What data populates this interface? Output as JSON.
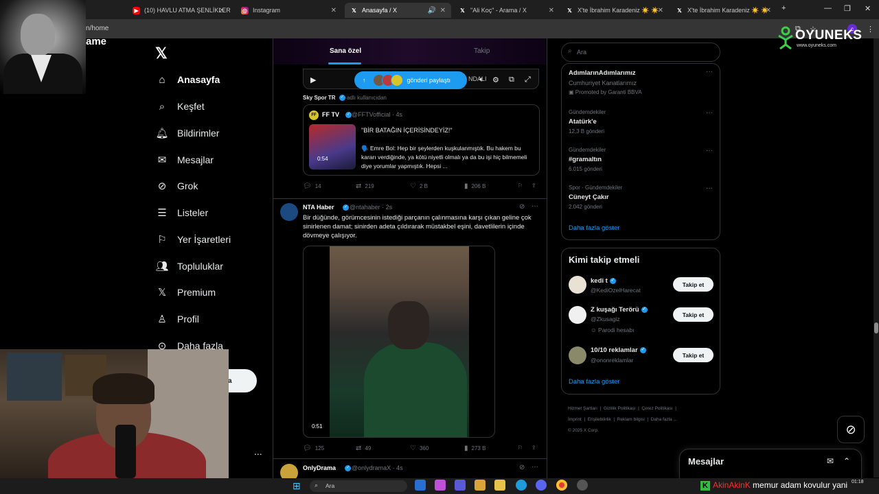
{
  "browser": {
    "tabs": [
      {
        "title": "(10) HAVLU ATMA ŞENLİKLERİ",
        "icon": "youtube-icon"
      },
      {
        "title": "Instagram",
        "icon": "instagram-icon"
      },
      {
        "title": "Anasayfa / X",
        "icon": "x-icon",
        "active": true
      },
      {
        "title": "\"Ali Koç\" - Arama / X",
        "icon": "x-icon"
      },
      {
        "title": "X'te İbrahim Karadeniz ☀️ ☀️",
        "icon": "x-icon"
      },
      {
        "title": "X'te İbrahim Karadeniz ☀️ ☀️",
        "icon": "x-icon"
      }
    ],
    "url": "n/home",
    "profile_initial": "c",
    "page_fragment": "ame"
  },
  "overlay_logo": {
    "name": "OYUNEKS",
    "site": "www.oyuneks.com"
  },
  "nav": {
    "items": [
      {
        "label": "Anasayfa",
        "icon": "home-icon"
      },
      {
        "label": "Keşfet",
        "icon": "search-icon"
      },
      {
        "label": "Bildirimler",
        "icon": "bell-icon"
      },
      {
        "label": "Mesajlar",
        "icon": "mail-icon"
      },
      {
        "label": "Grok",
        "icon": "grok-icon"
      },
      {
        "label": "Listeler",
        "icon": "list-icon"
      },
      {
        "label": "Yer İşaretleri",
        "icon": "bookmark-icon"
      },
      {
        "label": "Topluluklar",
        "icon": "people-icon"
      },
      {
        "label": "Premium",
        "icon": "x-icon"
      },
      {
        "label": "Profil",
        "icon": "person-icon"
      },
      {
        "label": "Daha fazla",
        "icon": "more-icon"
      }
    ],
    "post_button_fragment": "a",
    "account_more": "..."
  },
  "feed": {
    "tabs": [
      "Sana özel",
      "Takip"
    ],
    "share_pill": "gönderi paylaştı",
    "player_partial_text": "NDALI",
    "tweet1": {
      "source": "Sky Spor TR",
      "source_suffix": "adlı kullanıcıdan",
      "quote": {
        "avatar": "FF",
        "name": "FF TV",
        "handle": "@FFTVofficial · 4s",
        "duration": "0:54",
        "headline": "\"BİR BATAĞIN İÇERİSİNDEYİZ!\"",
        "body": "🗣️ Emre Bol: Hep bir şeylerden kuşkulanmıştık. Bu hakem bu kararı verdiğinde, ya kötü niyetli olmalı ya da bu işi hiç bilmemeli diye yorumlar yapmıştık. Hepsi ..."
      },
      "replies": "14",
      "reposts": "219",
      "likes": "2 B",
      "views": "206 B"
    },
    "tweet2": {
      "name": "NTA Haber",
      "handle": "@ntahaber · 2s",
      "text": "Bir düğünde, görümcesinin istediği parçanın çalınmasına karşı çıkan geline çok sinirlenen damat; sinirden adeta çıldırarak müstakbel eşini, davetlilerin içinde dövmeye çalışıyor.",
      "duration": "0:51",
      "replies": "125",
      "reposts": "49",
      "likes": "360",
      "views": "273 B"
    },
    "tweet3": {
      "name": "OnlyDrama",
      "handle": "@onlydramaX · 4s"
    }
  },
  "sidebar": {
    "search_placeholder": "Ara",
    "trends": [
      {
        "category": "",
        "name": "AdımlarınAdımlarımız",
        "count": "Cumhuriyet Kanatlarımız",
        "promoted": "Promoted by Garanti BBVA"
      },
      {
        "category": "Gündemdekiler",
        "name": "Atatürk'e",
        "count": "12,3 B gönderi"
      },
      {
        "category": "Gündemdekiler",
        "name": "#gramaltın",
        "count": "6.015 gönderi"
      },
      {
        "category": "Spor · Gündemdekiler",
        "name": "Cüneyt Çakır",
        "count": "2.042 gönderi"
      }
    ],
    "trends_show_more": "Daha fazla göster",
    "who_title": "Kimi takip etmeli",
    "who": [
      {
        "name": "kedi t",
        "handle": "@KediOzelHarecat",
        "note": ""
      },
      {
        "name": "Z kuşağı Terörü",
        "handle": "@Zkusagiz",
        "note": "Parodi hesabı"
      },
      {
        "name": "10/10 reklamlar",
        "handle": "@ononreklamlar",
        "note": ""
      }
    ],
    "follow_label": "Takip et",
    "who_show_more": "Daha fazla göster",
    "footer": [
      "Hizmet Şartları",
      "Gizlilik Politikası",
      "Çerez Politikası",
      "İmprint",
      "Erişilebilirlik",
      "Reklam bilgisi",
      "Daha fazla ...",
      "© 2025 X Corp."
    ]
  },
  "messages_dock": {
    "title": "Mesajlar"
  },
  "taskbar": {
    "search": "Ara",
    "time": "01:18",
    "date": ""
  },
  "ticker": {
    "user": "AkinAkinK",
    "message": "memur adam kovulur yani"
  },
  "colors": {
    "accent": "#1d9bf0",
    "border": "#2f3336",
    "muted": "#71767b"
  }
}
